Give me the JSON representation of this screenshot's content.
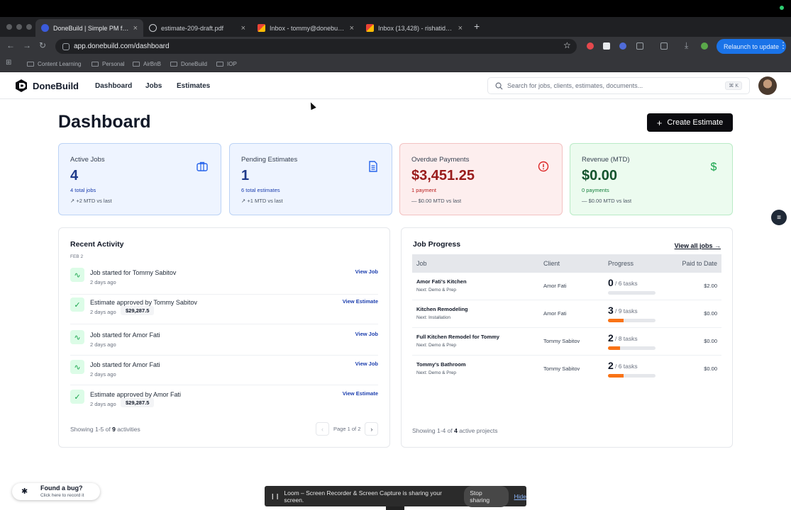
{
  "browser": {
    "tabs": [
      {
        "title": "DoneBuild | Simple PM for Re",
        "favicon": "donebuild-icon",
        "active": true
      },
      {
        "title": "estimate-209-draft.pdf",
        "favicon": "globe-icon",
        "active": false
      },
      {
        "title": "Inbox - tommy@donebuild.co",
        "favicon": "gmail-icon",
        "active": false
      },
      {
        "title": "Inbox (13,428) - rishatid7@g",
        "favicon": "gmail-icon",
        "active": false
      }
    ],
    "close_glyph": "×",
    "new_tab_glyph": "+",
    "url": "app.donebuild.com/dashboard",
    "relaunch_label": "Relaunch to update",
    "bookmarks": [
      "Content Learning",
      "Personal",
      "AirBnB",
      "DoneBuild",
      "IOP"
    ]
  },
  "header": {
    "brand": "DoneBuild",
    "nav": [
      "Dashboard",
      "Jobs",
      "Estimates"
    ],
    "search_placeholder": "Search for jobs, clients, estimates, documents...",
    "search_shortcut": "⌘ K"
  },
  "dashboard": {
    "title": "Dashboard",
    "create_label": "Create Estimate",
    "stats": [
      {
        "label": "Active Jobs",
        "value": "4",
        "sub": "4 total jobs",
        "trend": "+2 MTD vs last",
        "icon": "briefcase-icon",
        "theme": "blue"
      },
      {
        "label": "Pending Estimates",
        "value": "1",
        "sub": "6 total estimates",
        "trend": "+1 MTD vs last",
        "icon": "document-icon",
        "theme": "blue"
      },
      {
        "label": "Overdue Payments",
        "value": "$3,451.25",
        "sub": "1 payment",
        "trend": "$0.00 MTD vs last",
        "icon": "alert-circle-icon",
        "theme": "red"
      },
      {
        "label": "Revenue (MTD)",
        "value": "$0.00",
        "sub": "0 payments",
        "trend": "$0.00 MTD vs last",
        "icon": "dollar-icon",
        "theme": "green"
      }
    ],
    "activity": {
      "title": "Recent Activity",
      "date_header": "FEB 2",
      "items": [
        {
          "title": "Job started for Tommy Sabitov",
          "time": "2 days ago",
          "amount": "",
          "link": "View Job",
          "icon": "pulse-icon"
        },
        {
          "title": "Estimate approved by Tommy Sabitov",
          "time": "2 days ago",
          "amount": "$29,287.5",
          "link": "View Estimate",
          "icon": "check-circle-icon"
        },
        {
          "title": "Job started for Amor Fati",
          "time": "2 days ago",
          "amount": "",
          "link": "View Job",
          "icon": "pulse-icon"
        },
        {
          "title": "Job started for Amor Fati",
          "time": "2 days ago",
          "amount": "",
          "link": "View Job",
          "icon": "pulse-icon"
        },
        {
          "title": "Estimate approved by Amor Fati",
          "time": "2 days ago",
          "amount": "$29,287.5",
          "link": "View Estimate",
          "icon": "check-circle-icon"
        }
      ],
      "showing_prefix": "Showing 1-5 of",
      "showing_count": "9",
      "showing_suffix": "activities",
      "page_label": "Page 1 of 2"
    },
    "progress": {
      "title": "Job Progress",
      "view_all": "View all jobs",
      "columns": [
        "Job",
        "Client",
        "Progress",
        "Paid to Date"
      ],
      "rows": [
        {
          "job": "Amor Fati's Kitchen",
          "next": "Next: Demo & Prep",
          "client": "Amor Fati",
          "done": "0",
          "total": "/ 6 tasks",
          "fraction": 0,
          "paid": "$2.00"
        },
        {
          "job": "Kitchen Remodeling",
          "next": "Next: Installation",
          "client": "Amor Fati",
          "done": "3",
          "total": "/ 9 tasks",
          "fraction": 0.333,
          "paid": "$0.00"
        },
        {
          "job": "Full Kitchen Remodel for Tommy",
          "next": "Next: Demo & Prep",
          "client": "Tommy Sabitov",
          "done": "2",
          "total": "/ 8 tasks",
          "fraction": 0.25,
          "paid": "$0.00"
        },
        {
          "job": "Tommy's Bathroom",
          "next": "Next: Demo & Prep",
          "client": "Tommy Sabitov",
          "done": "2",
          "total": "/ 6 tasks",
          "fraction": 0.333,
          "paid": "$0.00"
        }
      ],
      "showing_prefix": "Showing 1-4 of",
      "showing_count": "4",
      "showing_suffix": "active projects"
    }
  },
  "bug_widget": {
    "title": "Found a bug?",
    "subtitle": "Click here to record it"
  },
  "loom_bar": {
    "message": "Loom – Screen Recorder & Screen Capture is sharing your screen.",
    "stop_label": "Stop sharing",
    "hide_label": "Hide"
  },
  "colors": {
    "accent": "#0b0b0f",
    "link": "#1e40af",
    "overdue": "#991b1b",
    "revenue": "#14532d",
    "progress": "#f97316"
  }
}
